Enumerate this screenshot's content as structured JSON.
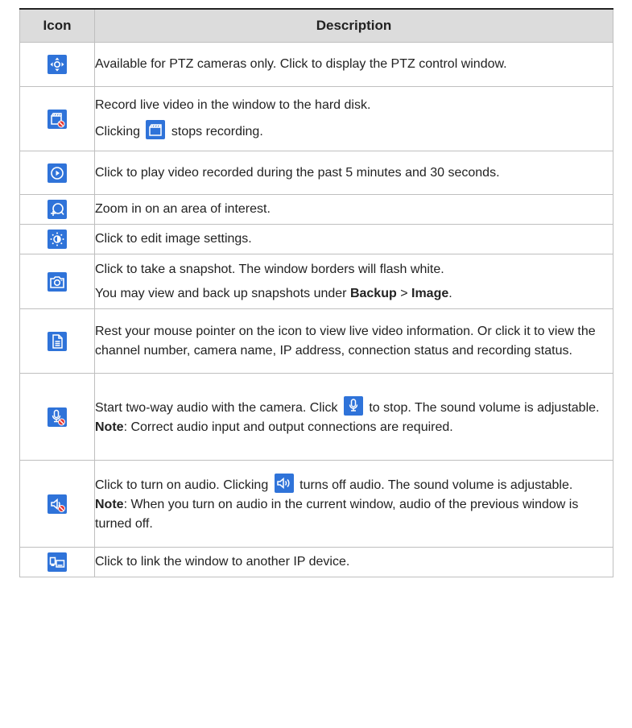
{
  "table": {
    "headers": {
      "icon": "Icon",
      "description": "Description"
    },
    "rows": [
      {
        "icon": "ptz-icon",
        "text": "Available for PTZ cameras only. Click to display the PTZ control window."
      },
      {
        "icon": "record-disabled-icon",
        "p1": "Record live video in the window to the hard disk.",
        "p2_before": "Clicking",
        "p2_inline_icon": "recording-icon",
        "p2_after": "stops recording."
      },
      {
        "icon": "play-icon",
        "text": "Click to play video recorded during the past 5 minutes and 30 seconds."
      },
      {
        "icon": "zoom-in-icon",
        "text": "Zoom in on an area of interest."
      },
      {
        "icon": "image-settings-icon",
        "text": "Click to edit image settings."
      },
      {
        "icon": "camera-snapshot-icon",
        "p1": "Click to take a snapshot. The window borders will flash white.",
        "p2_before": "You may view and back up snapshots under",
        "p2_bold1": "Backup",
        "p2_sep": ">",
        "p2_bold2": "Image",
        "p2_end": "."
      },
      {
        "icon": "document-info-icon",
        "text": "Rest your mouse pointer on the icon to view live video information. Or click it to view the channel number, camera name, IP address, connection status and recording status."
      },
      {
        "icon": "microphone-disabled-icon",
        "p1_before": "Start two-way audio with the camera. Click",
        "p1_inline_icon": "microphone-icon",
        "p1_after": "to stop. The sound volume is adjustable.",
        "note_label": "Note",
        "note_text": ": Correct audio input and output connections are required."
      },
      {
        "icon": "speaker-muted-icon",
        "p1_before": "Click to turn on audio. Clicking",
        "p1_inline_icon": "speaker-icon",
        "p1_after": "turns off audio. The sound volume is adjustable.",
        "note_label": "Note",
        "note_text": ": When you turn on audio in the current window, audio of the previous window is turned off."
      },
      {
        "icon": "link-device-icon",
        "text": "Click to link the window to another IP device."
      }
    ]
  },
  "colors": {
    "icon_bg": "#2f73d9",
    "header_bg": "#dcdcdc",
    "border": "#bfbfbf",
    "disabled_badge": "#e53935"
  }
}
